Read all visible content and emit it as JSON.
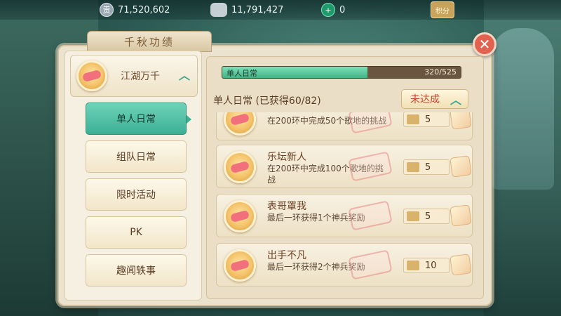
{
  "resources": {
    "gong_value": "71,520,602",
    "silver_value": "11,791,427",
    "jade_value": "0",
    "jifen_label": "积分"
  },
  "panel": {
    "title": "千秋功绩",
    "close_label": "✕"
  },
  "category": {
    "title": "江湖万千",
    "nav": [
      {
        "label": "单人日常",
        "active": true
      },
      {
        "label": "组队日常",
        "active": false
      },
      {
        "label": "限时活动",
        "active": false
      },
      {
        "label": "PK",
        "active": false
      },
      {
        "label": "趣闻轶事",
        "active": false
      }
    ]
  },
  "progress": {
    "label": "单人日常",
    "value_text": "320/525",
    "fraction": 0.6095
  },
  "section": {
    "title": "单人日常 (已获得60/82)",
    "status_label": "未达成"
  },
  "achievements": [
    {
      "name": "",
      "desc": "在200环中完成50个歌地的挑战",
      "reward": "5"
    },
    {
      "name": "乐坛新人",
      "desc": "在200环中完成100个歌地的挑战",
      "reward": "5"
    },
    {
      "name": "表哥罩我",
      "desc": "最后一环获得1个神兵奖励",
      "reward": "5"
    },
    {
      "name": "出手不凡",
      "desc": "最后一环获得2个神兵奖励",
      "reward": "10"
    }
  ],
  "colors": {
    "accent_green": "#3bb095",
    "close_red": "#e0624f",
    "status_red": "#c5482f"
  }
}
